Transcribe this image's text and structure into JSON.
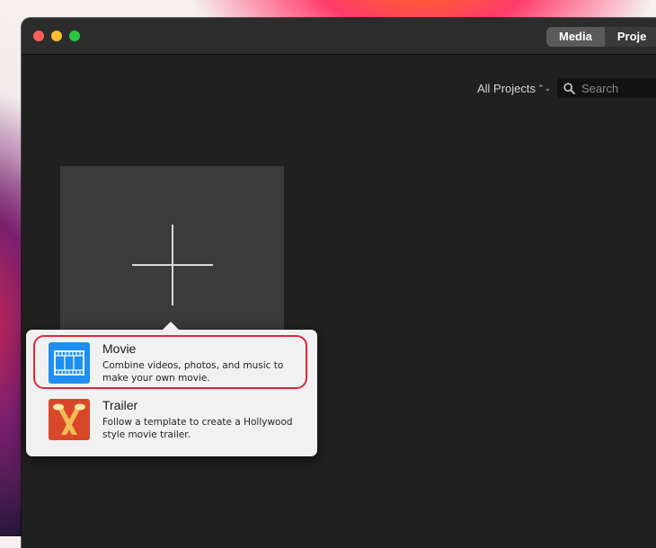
{
  "toolbar": {
    "tabs": [
      {
        "label": "Media",
        "active": true
      },
      {
        "label": "Proje",
        "active": false
      }
    ]
  },
  "browser": {
    "filter_label": "All Projects",
    "search_placeholder": "Search"
  },
  "new_project": {
    "icon": "plus-icon"
  },
  "popover": {
    "options": [
      {
        "title": "Movie",
        "description": "Combine videos, photos, and music to make your own movie.",
        "icon": "film-strip-icon",
        "highlighted": true
      },
      {
        "title": "Trailer",
        "description": "Follow a template to create a Hollywood style movie trailer.",
        "icon": "spotlight-icon",
        "highlighted": false
      }
    ]
  },
  "colors": {
    "highlight": "#e0273a",
    "movie_icon_bg": "#1e8ef0",
    "trailer_icon_bg": "#d9472a"
  }
}
